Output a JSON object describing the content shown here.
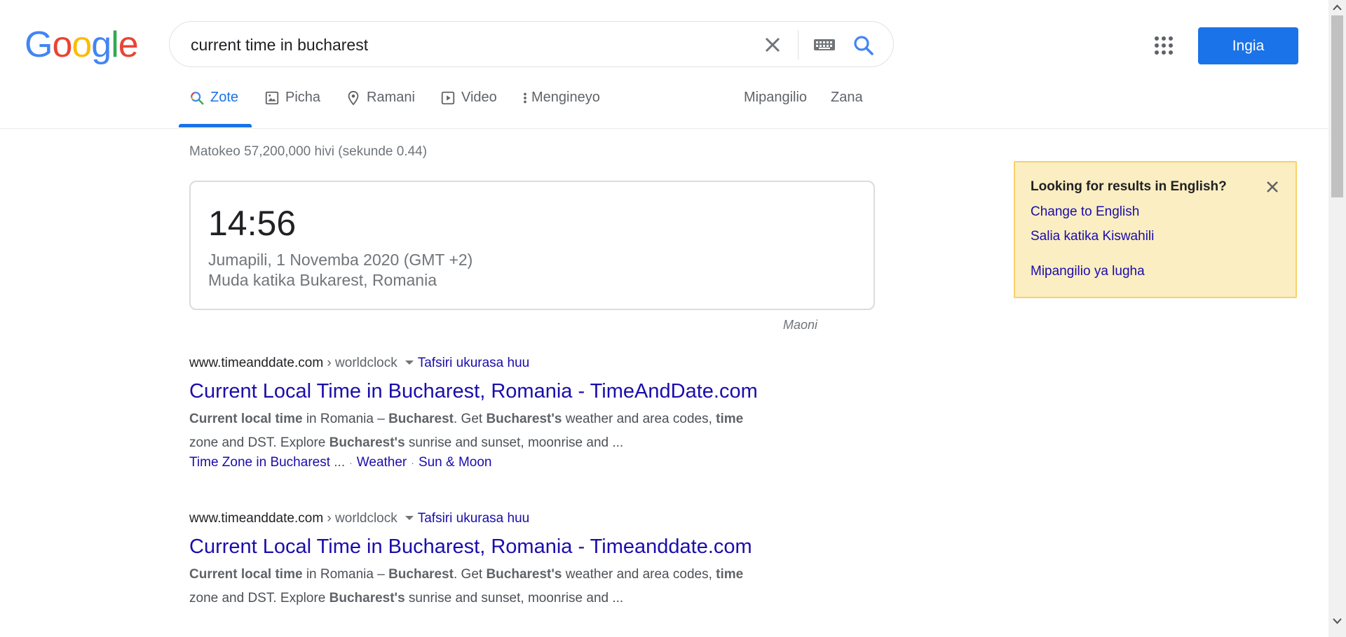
{
  "header": {
    "logo_letters": [
      "G",
      "o",
      "o",
      "g",
      "l",
      "e"
    ],
    "search_query": "current time in bucharest",
    "signin_label": "Ingia"
  },
  "tabs": [
    {
      "label": "Zote",
      "icon": "search-icon",
      "active": true
    },
    {
      "label": "Picha",
      "icon": "image-icon"
    },
    {
      "label": "Ramani",
      "icon": "map-pin-icon"
    },
    {
      "label": "Video",
      "icon": "video-icon"
    },
    {
      "label": "Mengineyo",
      "icon": "more-vert-icon"
    },
    {
      "label": "Mipangilio"
    },
    {
      "label": "Zana"
    }
  ],
  "stats": "Matokeo 57,200,000 hivi (sekunde 0.44)",
  "time_card": {
    "time": "14:56",
    "date": "Jumapili, 1 Novemba 2020 (GMT +2)",
    "location": "Muda katika Bukarest, Romania",
    "feedback": "Maoni"
  },
  "results": [
    {
      "domain": "www.timeanddate.com",
      "path": " › worldclock",
      "translate": "Tafsiri ukurasa huu",
      "title": "Current Local Time in Bucharest, Romania - TimeAndDate.com",
      "snippet_html_parts": [
        "Current local time",
        " in Romania – ",
        "Bucharest",
        ". Get ",
        "Bucharest's",
        " weather and area codes, ",
        "time",
        " zone and DST. Explore ",
        "Bucharest's",
        " sunrise and sunset, moonrise and ..."
      ],
      "sitelinks": [
        "Time Zone in Bucharest",
        "Weather",
        "Sun & Moon"
      ],
      "sitelink_ellipsis": " ..."
    },
    {
      "domain": "www.timeanddate.com",
      "path": " › worldclock",
      "translate": "Tafsiri ukurasa huu",
      "title": "Current Local Time in Bucharest, Romania - Timeanddate.com",
      "snippet_html_parts": [
        "Current local time",
        " in Romania – ",
        "Bucharest",
        ". Get ",
        "Bucharest's",
        " weather and area codes, ",
        "time",
        " zone and DST. Explore ",
        "Bucharest's",
        " sunrise and sunset, moonrise and ..."
      ]
    }
  ],
  "language_box": {
    "heading": "Looking for results in English?",
    "link1": "Change to English",
    "link2": "Salia katika Kiswahili",
    "link3": "Mipangilio ya lugha"
  },
  "colors": {
    "accent": "#1a73e8",
    "link": "#1a0dab",
    "logo": [
      "#4285f4",
      "#ea4335",
      "#fbbc05",
      "#4285f4",
      "#34a853",
      "#ea4335"
    ]
  }
}
